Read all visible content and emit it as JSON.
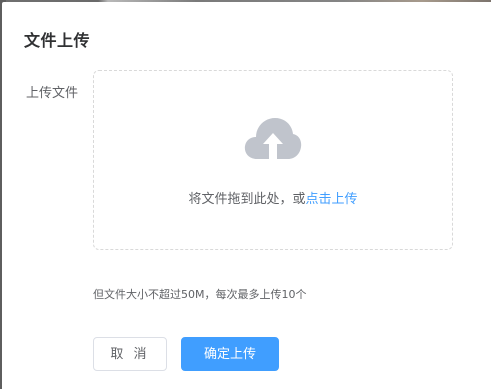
{
  "dialog": {
    "title": "文件上传",
    "field_label": "上传文件",
    "upload": {
      "icon": "cloud-upload-icon",
      "drop_text": "将文件拖到此处，或",
      "drop_link": "点击上传"
    },
    "tip": "但文件大小不超过50M，每次最多上传10个",
    "buttons": {
      "cancel": "取 消",
      "confirm": "确定上传"
    }
  },
  "colors": {
    "primary": "#409eff",
    "icon": "#c0c4cc",
    "text": "#606266",
    "title": "#303133",
    "border": "#d9d9d9"
  }
}
